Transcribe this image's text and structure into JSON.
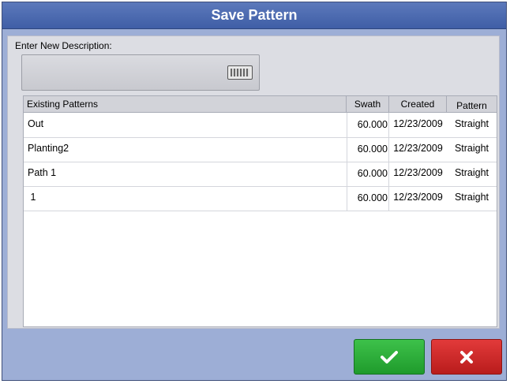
{
  "dialog": {
    "title": "Save Pattern"
  },
  "description": {
    "label": "Enter New Description:",
    "value": ""
  },
  "table": {
    "headers": [
      "Existing Patterns",
      "Swath",
      "Created",
      "Pattern"
    ],
    "rows": [
      {
        "name": "Out",
        "swath": "60.000",
        "created": "12/23/2009",
        "pattern": "Straight"
      },
      {
        "name": "Planting2",
        "swath": "60.000",
        "created": "12/23/2009",
        "pattern": "Straight"
      },
      {
        "name": "Path 1",
        "swath": "60.000",
        "created": "12/23/2009",
        "pattern": "Straight"
      },
      {
        "name": " 1",
        "swath": "60.000",
        "created": "12/23/2009",
        "pattern": "Straight"
      }
    ]
  },
  "buttons": {
    "confirm_icon": "checkmark-icon",
    "cancel_icon": "x-icon",
    "confirm_color": "#2fb13c",
    "cancel_color": "#d02a2a"
  }
}
